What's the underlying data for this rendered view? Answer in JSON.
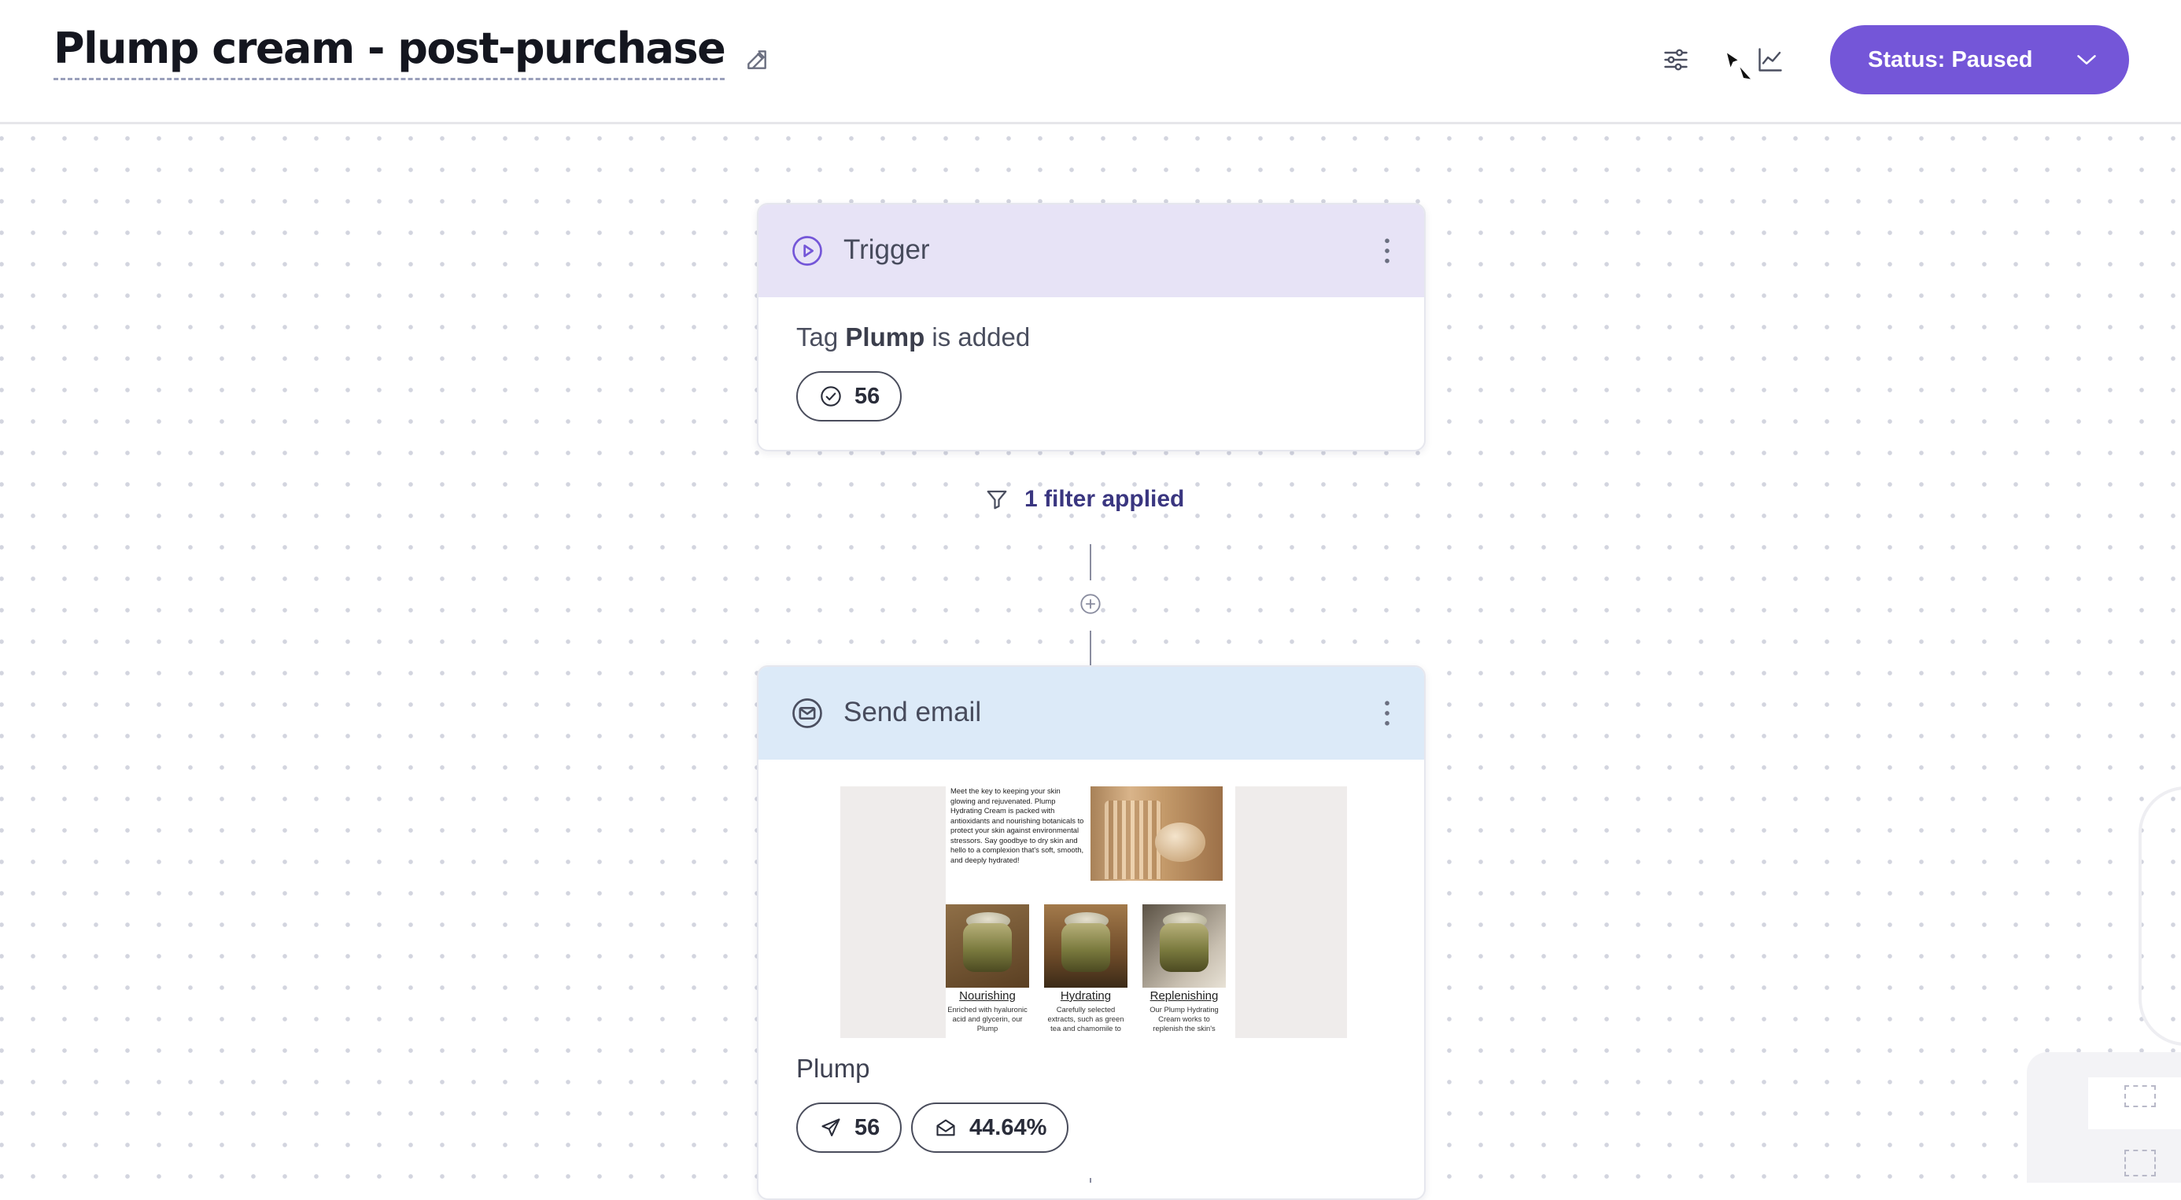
{
  "header": {
    "title": "Plump cream - post-purchase",
    "status_label": "Status: Paused"
  },
  "icons": {
    "edit": "edit-icon",
    "settings": "sliders-icon",
    "cursor": "cursor-icon",
    "analytics": "chart-icon",
    "chevron": "chevron-down-icon"
  },
  "colors": {
    "accent": "#7456d8",
    "trigger_header": "#e7e3f6",
    "email_header": "#dceaf8",
    "filter_text": "#3a3680"
  },
  "trigger": {
    "label": "Trigger",
    "text_prefix": "Tag",
    "tag": "Plump",
    "text_suffix": "is added",
    "count": "56"
  },
  "filter": {
    "label": "1 filter applied"
  },
  "email": {
    "label": "Send email",
    "name": "Plump",
    "sent_count": "56",
    "open_rate": "44.64%",
    "preview": {
      "intro": "Meet the key to keeping your skin glowing and rejuvenated. Plump Hydrating Cream is packed with antioxidants and nourishing botanicals to protect your skin against environmental stressors. Say goodbye to dry skin and hello to a complexion that's soft, smooth, and deeply hydrated!",
      "products": [
        {
          "title": "Nourishing",
          "desc": "Enriched with hyaluronic acid and glycerin, our Plump"
        },
        {
          "title": "Hydrating",
          "desc": "Carefully selected extracts, such as green tea and chamomile to"
        },
        {
          "title": "Replenishing",
          "desc": "Our Plump Hydrating Cream works to replenish the skin's"
        }
      ]
    }
  }
}
